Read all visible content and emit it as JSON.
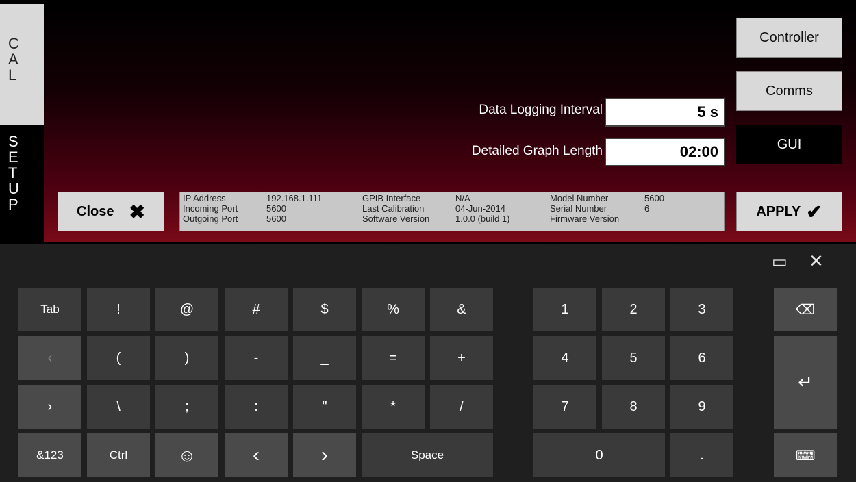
{
  "sidebar": {
    "cal_letters": [
      "C",
      "A",
      "L"
    ],
    "setup_letters": [
      "S",
      "E",
      "T",
      "U",
      "P"
    ]
  },
  "fields": {
    "logging_label": "Data Logging Interval",
    "logging_value": "5 s",
    "graph_label": "Detailed Graph Length",
    "graph_value": "02:00"
  },
  "right_nav": {
    "controller": "Controller",
    "comms": "Comms",
    "gui": "GUI"
  },
  "buttons": {
    "close": "Close",
    "close_icon": "✖",
    "apply": "APPLY",
    "apply_icon": "✔"
  },
  "info": {
    "ip_label": "IP Address",
    "ip_value": "192.168.1.111",
    "in_label": "Incoming Port",
    "in_value": "5600",
    "out_label": "Outgoing Port",
    "out_value": "5600",
    "gpib_label": "GPIB Interface",
    "gpib_value": "N/A",
    "cal_label": "Last Calibration",
    "cal_value": "04-Jun-2014",
    "sw_label": "Software Version",
    "sw_value": "1.0.0 (build 1)",
    "model_label": "Model Number",
    "model_value": "5600",
    "serial_label": "Serial Number",
    "serial_value": "6",
    "fw_label": "Firmware Version"
  },
  "keyboard": {
    "dock_icon": "▭",
    "close_icon": "✕",
    "row1": [
      "Tab",
      "!",
      "@",
      "#",
      "$",
      "%",
      "&"
    ],
    "row2": [
      "(",
      ")",
      "-",
      "_",
      "=",
      "+"
    ],
    "row3": [
      "\\",
      ";",
      ":",
      "\"",
      "*",
      "/"
    ],
    "row4": [
      "&123",
      "Ctrl",
      "☺",
      "‹",
      "›",
      "Space"
    ],
    "numpad": [
      "1",
      "2",
      "3",
      "4",
      "5",
      "6",
      "7",
      "8",
      "9",
      "0",
      "."
    ],
    "backspace": "⌫",
    "enter": "↵",
    "layout_icon": "⌨",
    "prev_icon": "‹",
    "next_icon": "›"
  }
}
